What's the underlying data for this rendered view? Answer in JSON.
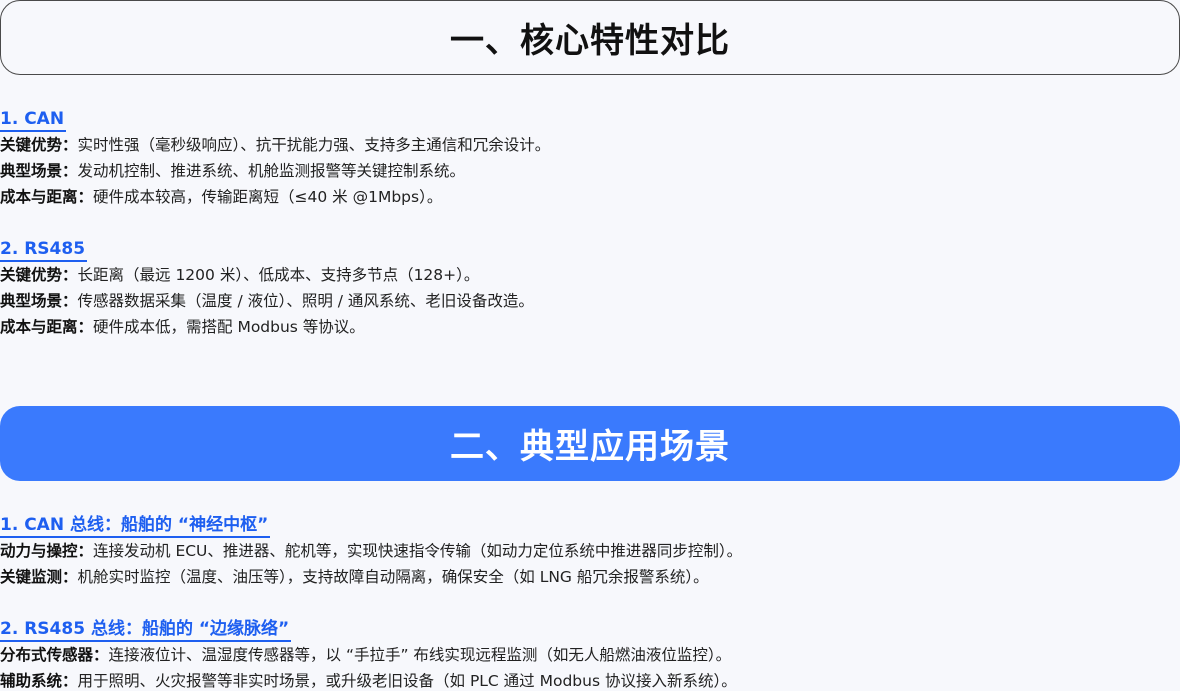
{
  "banner1": {
    "title": "一、核心特性对比"
  },
  "banner2": {
    "title": "二、典型应用场景"
  },
  "can": {
    "heading": "1. CAN",
    "items": [
      {
        "label": "关键优势：",
        "text": "实时性强（毫秒级响应）、抗干扰能力强、支持多主通信和冗余设计。"
      },
      {
        "label": "典型场景：",
        "text": "发动机控制、推进系统、机舱监测报警等关键控制系统。"
      },
      {
        "label": "成本与距离：",
        "text": "硬件成本较高，传输距离短（≤40 米 @1Mbps）。"
      }
    ]
  },
  "rs485": {
    "heading": "2. RS485",
    "items": [
      {
        "label": "关键优势：",
        "text": "长距离（最远 1200 米）、低成本、支持多节点（128+）。"
      },
      {
        "label": "典型场景：",
        "text": "传感器数据采集（温度 / 液位）、照明 / 通风系统、老旧设备改造。"
      },
      {
        "label": "成本与距离：",
        "text": "硬件成本低，需搭配 Modbus 等协议。"
      }
    ]
  },
  "can_app": {
    "heading": "1. CAN 总线：船舶的 “神经中枢”",
    "items": [
      {
        "label": "动力与操控：",
        "text": "连接发动机 ECU、推进器、舵机等，实现快速指令传输（如动力定位系统中推进器同步控制）。"
      },
      {
        "label": "关键监测：",
        "text": "机舱实时监控（温度、油压等），支持故障自动隔离，确保安全（如 LNG 船冗余报警系统）。"
      }
    ]
  },
  "rs485_app": {
    "heading": "2. RS485 总线：船舶的 “边缘脉络”",
    "items": [
      {
        "label": "分布式传感器：",
        "text": "连接液位计、温湿度传感器等，以 “手拉手” 布线实现远程监测（如无人船燃油液位监控）。"
      },
      {
        "label": "辅助系统：",
        "text": "用于照明、火灾报警等非实时场景，或升级老旧设备（如 PLC 通过 Modbus 协议接入新系统）。"
      }
    ]
  }
}
